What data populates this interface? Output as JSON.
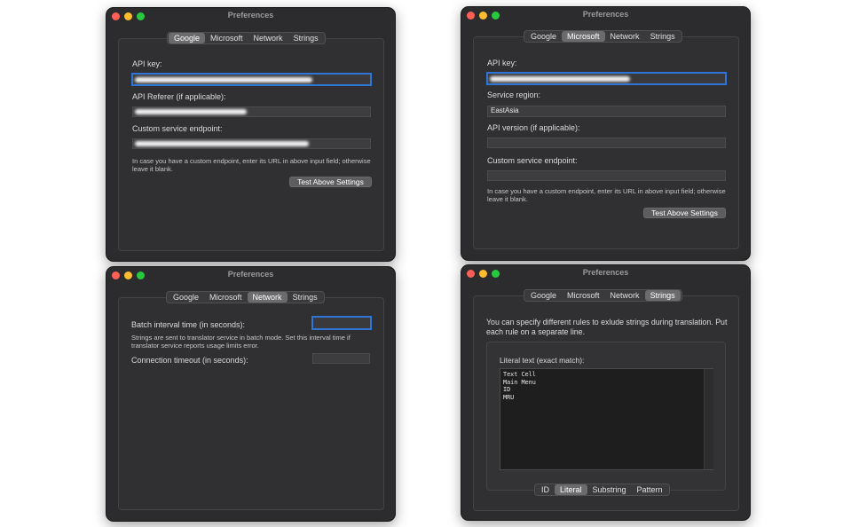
{
  "window_title": "Preferences",
  "tabs": [
    "Google",
    "Microsoft",
    "Network",
    "Strings"
  ],
  "google": {
    "api_key_label": "API key:",
    "api_referer_label": "API Referer (if applicable):",
    "endpoint_label": "Custom service endpoint:",
    "hint": "In case you have a custom endpoint, enter its URL in above input field; otherwise leave it blank.",
    "test_button": "Test Above Settings"
  },
  "microsoft": {
    "api_key_label": "API key:",
    "region_label": "Service region:",
    "region_value": "EastAsia",
    "api_version_label": "API version (if applicable):",
    "endpoint_label": "Custom service endpoint:",
    "hint": "In case you have a custom endpoint, enter its URL in above input field; otherwise leave it blank.",
    "test_button": "Test Above Settings"
  },
  "network": {
    "batch_label": "Batch interval time (in seconds):",
    "batch_hint": "Strings are sent to translator service in batch mode. Set this interval time if translator service reports usage limits error.",
    "timeout_label": "Connection timeout (in seconds):"
  },
  "strings": {
    "intro": "You can specify different rules to exlude strings during translation. Put each rule on a separate line.",
    "literal_label": "Literal text (exact match):",
    "literal_text": "Text Cell\nMain Menu\nID\nMRU",
    "sub_tabs": [
      "ID",
      "Literal",
      "Substring",
      "Pattern"
    ]
  },
  "colors": {
    "focus": "#2f75d6",
    "window_bg": "#2c2c2e",
    "active_tab": "#6b6b6d"
  }
}
